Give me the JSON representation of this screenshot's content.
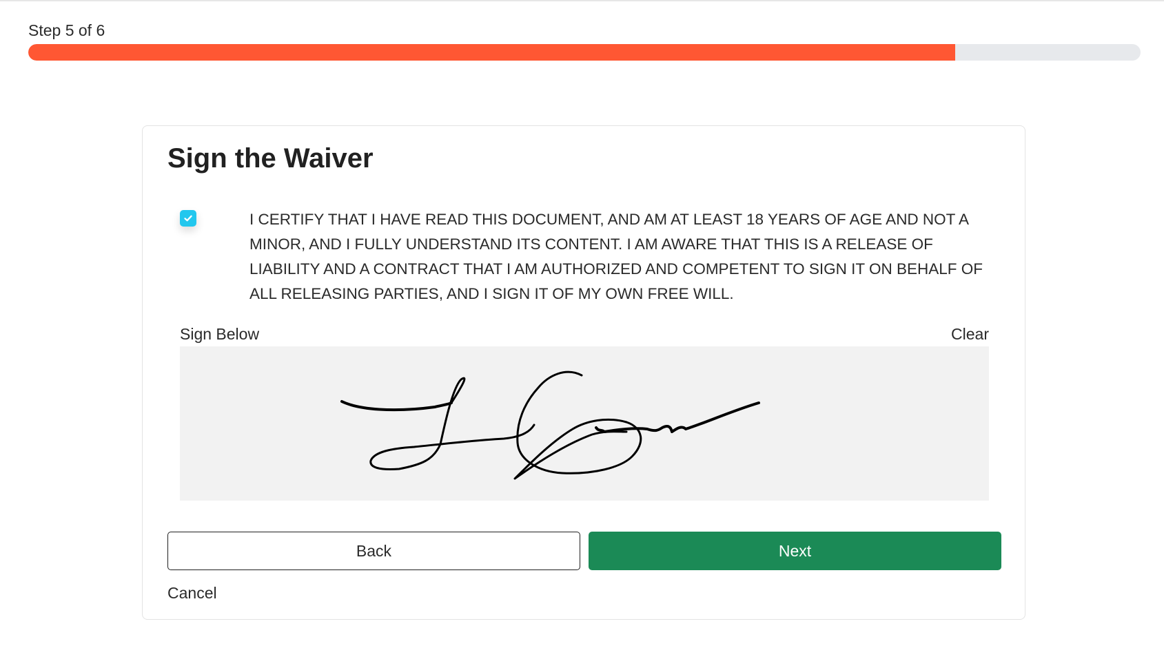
{
  "progress": {
    "label": "Step 5 of 6",
    "fraction": 0.8333
  },
  "card": {
    "title": "Sign the Waiver",
    "agreement": {
      "checked": true,
      "text": "I CERTIFY THAT I HAVE READ THIS DOCUMENT, AND AM AT LEAST 18 YEARS OF AGE AND NOT A MINOR, AND I FULLY UNDERSTAND ITS CONTENT. I AM AWARE THAT THIS IS A RELEASE OF LIABILITY AND A CONTRACT THAT I AM AUTHORIZED AND COMPETENT TO SIGN IT ON BEHALF OF ALL RELEASING PARTIES, AND I SIGN IT OF MY OWN FREE WILL."
    },
    "signature": {
      "label": "Sign Below",
      "clear_label": "Clear"
    },
    "buttons": {
      "back_label": "Back",
      "next_label": "Next",
      "cancel_label": "Cancel"
    }
  },
  "colors": {
    "progress_fill": "#ff5733",
    "progress_track": "#e7e9ec",
    "checkbox": "#22c7ee",
    "next_button": "#1b8a56",
    "signature_pad": "#f2f2f2"
  },
  "icons": {
    "checkbox": "check-icon"
  }
}
